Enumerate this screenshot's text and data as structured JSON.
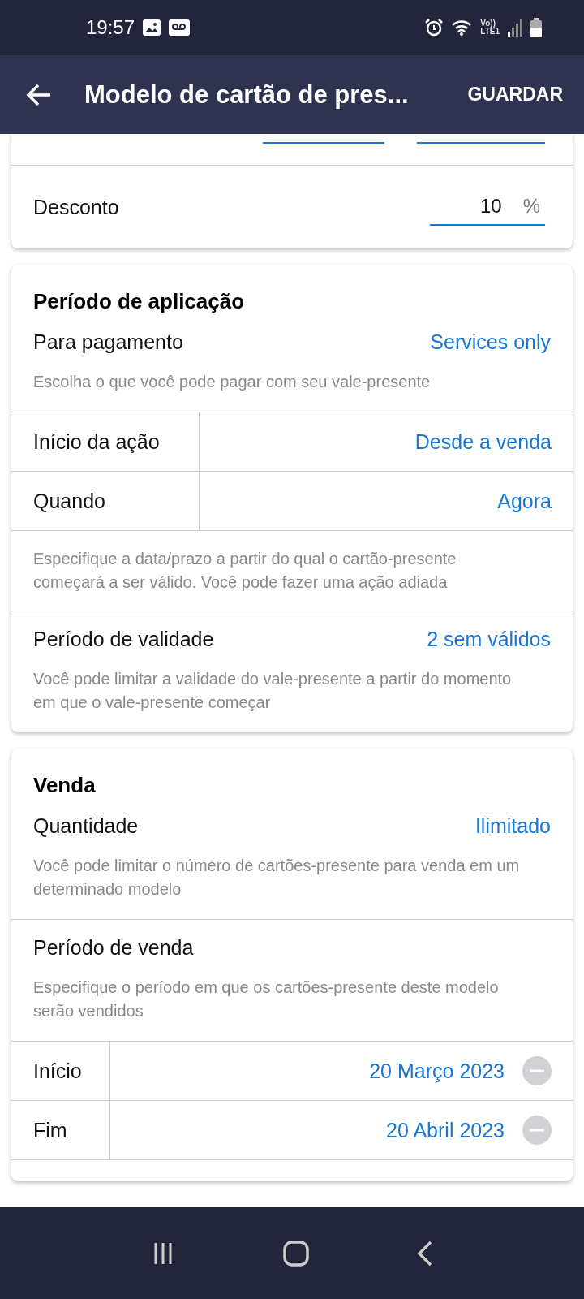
{
  "status_bar": {
    "time": "19:57",
    "network": "Vo))\nLTE1"
  },
  "app_bar": {
    "title": "Modelo de cartão de pres...",
    "action": "GUARDAR"
  },
  "cards": [
    {
      "items": [
        {
          "kind": "fields"
        },
        {
          "kind": "percent",
          "label": "Desconto",
          "value": "10",
          "unit": "%"
        }
      ]
    },
    {
      "title": "Período de aplicação",
      "items": [
        {
          "kind": "setting",
          "label": "Para pagamento",
          "value": "Services only",
          "hint": "Escolha o que você pode pagar com seu vale-presente"
        },
        {
          "kind": "cells",
          "narrow": false,
          "rows": [
            {
              "label": "Início da ação",
              "value": "Desde a venda",
              "removable": false
            },
            {
              "label": "Quando",
              "value": "Agora",
              "removable": false
            }
          ],
          "hint": "Especifique a data/prazo a partir do qual o cartão-presente começará a ser válido. Você pode fazer uma ação adiada"
        },
        {
          "kind": "setting",
          "label": "Período de validade",
          "value": "2 sem válidos",
          "hint": "Você pode limitar a validade do vale-presente a partir do momento em que o vale-presente começar"
        }
      ]
    },
    {
      "title": "Venda",
      "items": [
        {
          "kind": "setting",
          "label": "Quantidade",
          "value": "Ilimitado",
          "hint": "Você pode limitar o número de cartões-presente para venda em um determinado modelo"
        },
        {
          "kind": "setting",
          "label": "Período de venda",
          "hint": "Especifique o período em que os cartões-presente deste modelo serão vendidos"
        },
        {
          "kind": "cells",
          "narrow": true,
          "rows": [
            {
              "label": "Início",
              "value": "20 Março 2023",
              "removable": true
            },
            {
              "label": "Fim",
              "value": "20 Abril 2023",
              "removable": true
            }
          ]
        }
      ]
    }
  ]
}
